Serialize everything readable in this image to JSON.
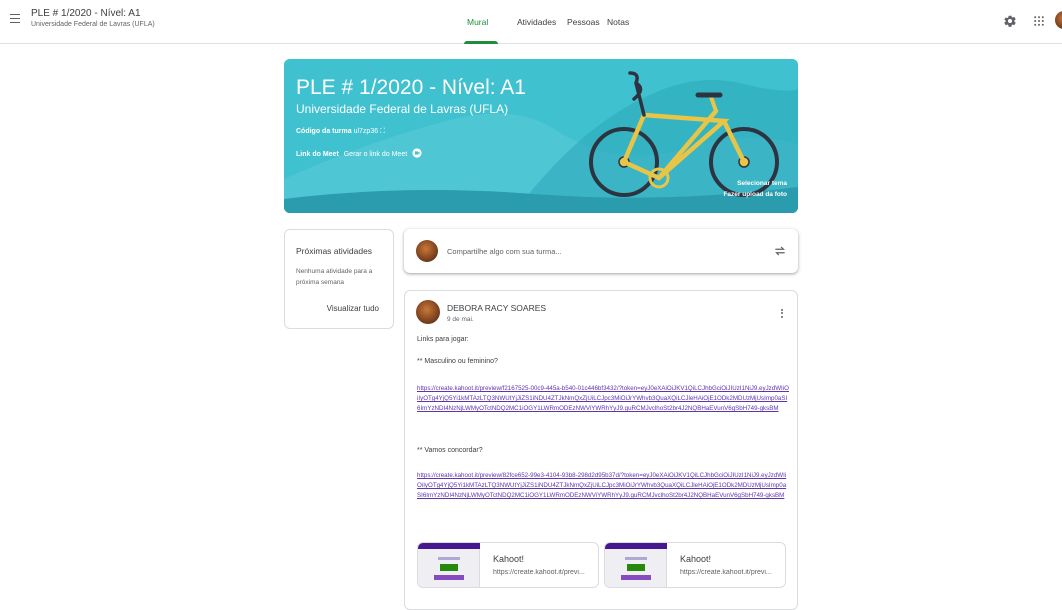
{
  "header": {
    "class_title": "PLE # 1/2020 - Nível: A1",
    "class_subtitle": "Universidade Federal de Lavras (UFLA)",
    "tabs": [
      {
        "label": "Mural",
        "active": true
      },
      {
        "label": "Atividades",
        "active": false
      },
      {
        "label": "Pessoas",
        "active": false
      },
      {
        "label": "Notas",
        "active": false
      }
    ],
    "icons": [
      "menu-icon",
      "gear-icon",
      "apps-grid-icon",
      "avatar"
    ]
  },
  "banner": {
    "title": "PLE # 1/2020 - Nível: A1",
    "subtitle": "Universidade Federal de Lavras (UFLA)",
    "code_label": "Código da turma",
    "code_value": "ul7zp36",
    "meet_label": "Link do Meet",
    "meet_link": "Gerar o link do Meet",
    "select_theme": "Selecionar tema",
    "upload_photo": "Fazer upload da foto",
    "bg_color": "#3fc1d0"
  },
  "upcoming": {
    "title": "Próximas atividades",
    "empty": "Nenhuma atividade para a próxima semana",
    "view_all": "Visualizar tudo"
  },
  "share": {
    "placeholder": "Compartilhe algo com sua turma..."
  },
  "post": {
    "author": "DEBORA RACY SOARES",
    "date": "9 de mai.",
    "intro": "Links para jogar:",
    "item1": "** Masculino ou feminino?",
    "link1": "https://create.kahoot.it/preview/f2167525-00c9-445a-b540-01c446bf3432/?token=eyJ0eXAiOiJKV1QiLCJhbGciOiJIUzI1NiJ9.eyJzdWIiOiIyOTg4YjQ5Yi1kMTAzLTQ3NWUtYjJiZS1iNDU4ZTJkNmQxZjUiLCJpc3MiOiJrYWhvb3QuaXQiLCJleHAiOjE1ODk2MDUzMjUsImp0aSI6ImYzNDI4NzNjLWMyOTctNDQ2MC1iOGY1LWRmODEzNWViYWRhYyJ9.guRCMJvclhoSt2br4J2NQBHaEVunV6gSbH749-gksBM",
    "item2": "** Vamos concordar?",
    "link2": "https://create.kahoot.it/preview/82fce652-99e3-4104-93b8-298d2d95b37d/?token=eyJ0eXAiOiJKV1QiLCJhbGciOiJIUzI1NiJ9.eyJzdWIiOiIyOTg4YjQ5Yi1kMTAzLTQ3NWUtYjJiZS1iNDU4ZTJkNmQxZjUiLCJpc3MiOiJrYWhvb3QuaXQiLCJleHAiOjE1ODk2MDUzMjUsImp0aSI6ImYzNDI4NzNjLWMyOTctNDQ2MC1iOGY1LWRmODEzNWViYWRhYyJ9.guRCMJvclhoSt2br4J2NQBHaEVunV6gSbH749-gksBM",
    "attachments": [
      {
        "title": "Kahoot!",
        "url": "https://create.kahoot.it/previ..."
      },
      {
        "title": "Kahoot!",
        "url": "https://create.kahoot.it/previ..."
      }
    ]
  },
  "colors": {
    "accent": "#1e8e3e",
    "link": "#5e35b1"
  }
}
